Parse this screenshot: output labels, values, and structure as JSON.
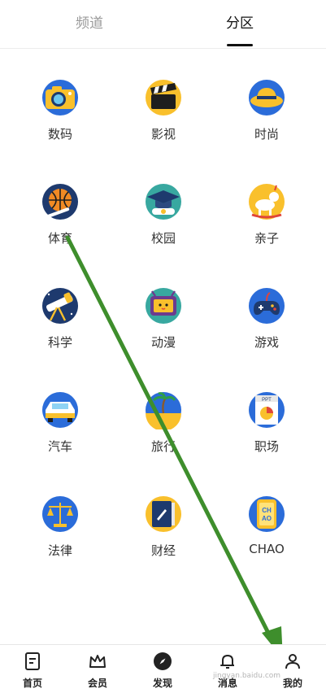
{
  "tabs": {
    "channel": "频道",
    "zone": "分区"
  },
  "categories": [
    {
      "label": "数码",
      "icon": "camera-icon"
    },
    {
      "label": "影视",
      "icon": "clapperboard-icon"
    },
    {
      "label": "时尚",
      "icon": "hat-icon"
    },
    {
      "label": "体育",
      "icon": "basketball-icon"
    },
    {
      "label": "校园",
      "icon": "graduation-cap-icon"
    },
    {
      "label": "亲子",
      "icon": "rocking-horse-icon"
    },
    {
      "label": "科学",
      "icon": "telescope-icon"
    },
    {
      "label": "动漫",
      "icon": "tv-character-icon"
    },
    {
      "label": "游戏",
      "icon": "gamepad-icon"
    },
    {
      "label": "汽车",
      "icon": "car-icon"
    },
    {
      "label": "旅行",
      "icon": "palm-beach-icon"
    },
    {
      "label": "职场",
      "icon": "ppt-chart-icon"
    },
    {
      "label": "法律",
      "icon": "scales-icon"
    },
    {
      "label": "财经",
      "icon": "finance-book-icon"
    },
    {
      "label": "CHAO",
      "icon": "chao-phone-icon"
    }
  ],
  "bottom_nav": [
    {
      "label": "首页",
      "icon": "home-doc-icon"
    },
    {
      "label": "会员",
      "icon": "crown-icon"
    },
    {
      "label": "发现",
      "icon": "compass-icon"
    },
    {
      "label": "消息",
      "icon": "bell-icon"
    },
    {
      "label": "我的",
      "icon": "user-icon"
    }
  ],
  "colors": {
    "accent_yellow": "#F9C02C",
    "navy": "#1E3A6E",
    "blue": "#2B6CD9",
    "arrow_green": "#3E8E2C"
  },
  "watermark": "jingyan.baidu.com"
}
